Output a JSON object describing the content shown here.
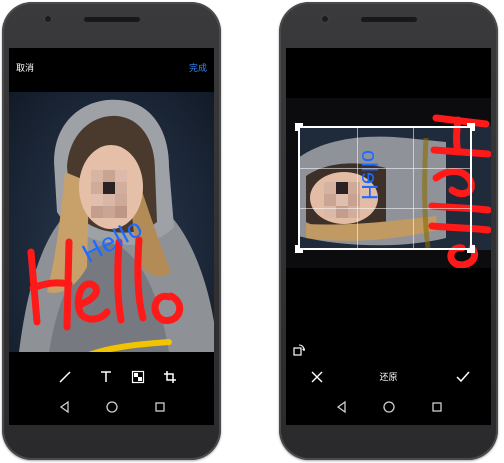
{
  "left_screen": {
    "header": {
      "cancel_label": "取消",
      "done_label": "完成"
    },
    "doodles": {
      "blue_text": "Hello"
    },
    "toolbar": {
      "items": [
        {
          "icon": "pen-icon"
        },
        {
          "icon": "text-icon"
        },
        {
          "icon": "mosaic-icon"
        },
        {
          "icon": "crop-icon"
        }
      ]
    }
  },
  "right_screen": {
    "doodles": {
      "blue_text": "Hello"
    },
    "bottom_bar": {
      "restore_label": "还原",
      "cancel_icon": "close-icon",
      "confirm_icon": "check-icon"
    },
    "rotate_icon": "rotate-icon"
  },
  "system_nav": {
    "icons": [
      "back-icon",
      "home-icon",
      "recents-icon"
    ]
  },
  "colors": {
    "accent_blue": "#2f8cff",
    "doodle_red": "#ff1a1a",
    "doodle_blue": "#1e6bff",
    "doodle_yellow": "#f2c400"
  }
}
